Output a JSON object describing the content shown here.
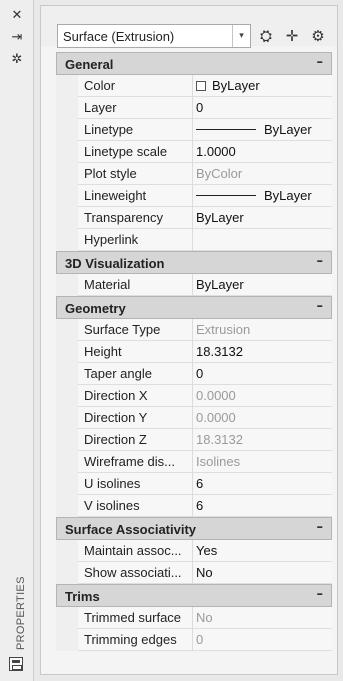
{
  "sidebar": {
    "close_glyph": "✕",
    "pin_glyph": "⇥",
    "settings_glyph": "✲",
    "vertical_label": "PROPERTIES"
  },
  "toolbar": {
    "object_type": "Surface (Extrusion)",
    "dropdown_arrow": "▾",
    "quick_select_glyph": "⛭",
    "pick_glyph": "✛",
    "toggle_pickadd_glyph": "⚙"
  },
  "sections": {
    "general": {
      "title": "General",
      "collapse": "–",
      "rows": [
        {
          "name": "Color",
          "value": "ByLayer"
        },
        {
          "name": "Layer",
          "value": "0"
        },
        {
          "name": "Linetype",
          "value": "ByLayer"
        },
        {
          "name": "Linetype scale",
          "value": "1.0000"
        },
        {
          "name": "Plot style",
          "value": "ByColor"
        },
        {
          "name": "Lineweight",
          "value": "ByLayer"
        },
        {
          "name": "Transparency",
          "value": "ByLayer"
        },
        {
          "name": "Hyperlink",
          "value": ""
        }
      ]
    },
    "visualization": {
      "title": "3D Visualization",
      "collapse": "–",
      "rows": [
        {
          "name": "Material",
          "value": "ByLayer"
        }
      ]
    },
    "geometry": {
      "title": "Geometry",
      "collapse": "–",
      "rows": [
        {
          "name": "Surface Type",
          "value": "Extrusion"
        },
        {
          "name": "Height",
          "value": "18.3132"
        },
        {
          "name": "Taper angle",
          "value": "0"
        },
        {
          "name": "Direction X",
          "value": "0.0000"
        },
        {
          "name": "Direction Y",
          "value": "0.0000"
        },
        {
          "name": "Direction Z",
          "value": "18.3132"
        },
        {
          "name": "Wireframe dis...",
          "value": "Isolines"
        },
        {
          "name": "U isolines",
          "value": "6"
        },
        {
          "name": "V isolines",
          "value": "6"
        }
      ]
    },
    "associativity": {
      "title": "Surface Associativity",
      "collapse": "–",
      "rows": [
        {
          "name": "Maintain assoc...",
          "value": "Yes"
        },
        {
          "name": "Show associati...",
          "value": "No"
        }
      ]
    },
    "trims": {
      "title": "Trims",
      "collapse": "–",
      "rows": [
        {
          "name": "Trimmed surface",
          "value": "No"
        },
        {
          "name": "Trimming edges",
          "value": "0"
        }
      ]
    }
  }
}
